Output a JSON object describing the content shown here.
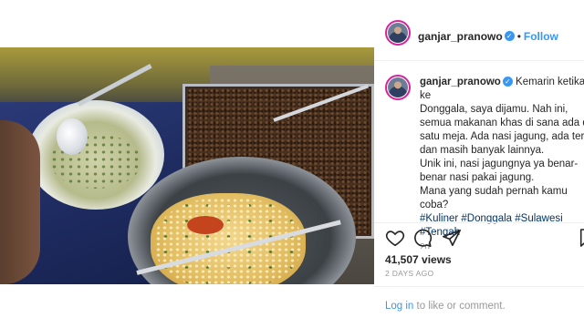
{
  "header": {
    "username": "ganjar_pranowo",
    "separator": "•",
    "follow_label": "Follow"
  },
  "post": {
    "username": "ganjar_pranowo",
    "caption_lines": [
      "Kemarin ketika ke",
      "Donggala, saya dijamu. Nah ini,",
      "semua makanan khas di sana ada di",
      "satu meja. Ada nasi jagung, ada teri,",
      "dan masih banyak lainnya.",
      "Unik ini, nasi jagungnya ya benar-",
      "benar nasi pakai jagung.",
      "Mana yang sudah pernah kamu coba?"
    ],
    "hashtags_line1": [
      "#Kuliner",
      "#Donggala",
      "#Sulawesi"
    ],
    "hashtags_line2": [
      "#Tengah"
    ],
    "comment_time": "2d"
  },
  "stats": {
    "views": "41,507 views",
    "posted": "2 DAYS AGO"
  },
  "login": {
    "link_label": "Log in",
    "rest": " to like or comment."
  },
  "icons": {
    "like": "heart-icon",
    "comment": "comment-icon",
    "share": "share-icon",
    "verified": "verified-badge-icon"
  },
  "colors": {
    "accent": "#3897f0",
    "hashtag": "#003569",
    "muted": "#999999",
    "story_ring": "#d6249f"
  }
}
